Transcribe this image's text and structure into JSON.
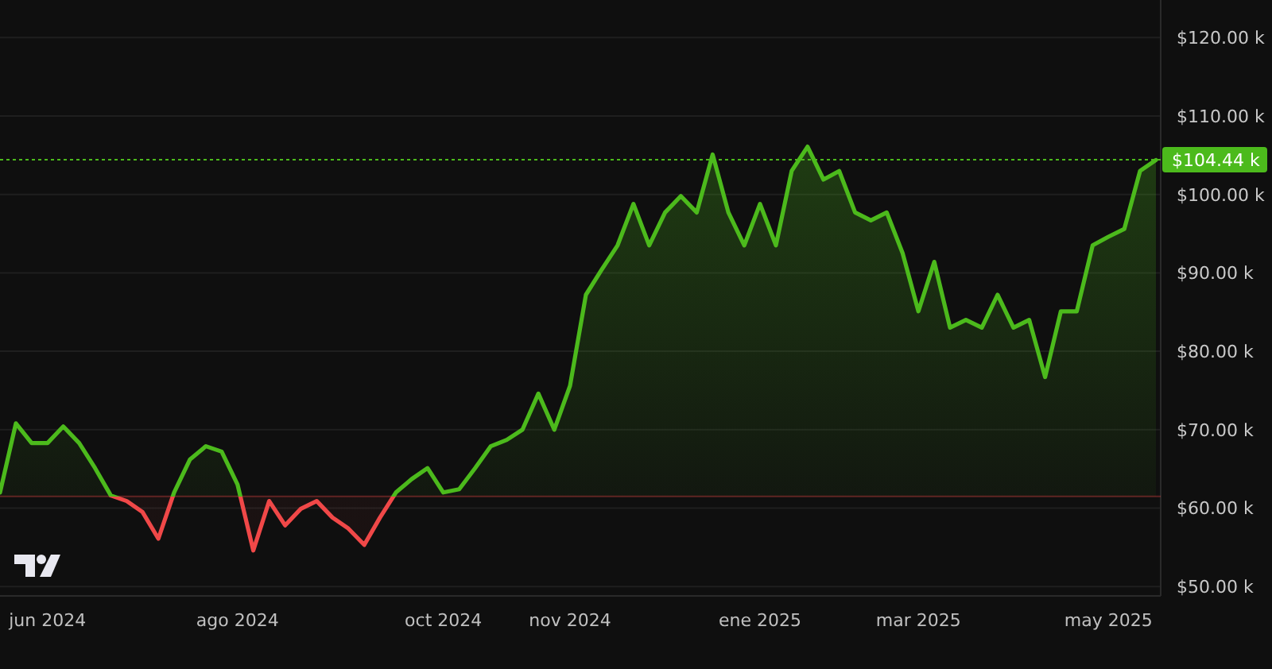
{
  "chart": {
    "chart_data": {
      "type": "area",
      "grid": true,
      "categories": [
        null,
        null,
        null,
        "jun 2024",
        null,
        null,
        null,
        null,
        null,
        null,
        null,
        null,
        null,
        null,
        null,
        "ago 2024",
        null,
        null,
        null,
        null,
        null,
        null,
        null,
        null,
        null,
        null,
        null,
        null,
        "oct 2024",
        null,
        null,
        null,
        null,
        null,
        null,
        null,
        "nov 2024",
        null,
        null,
        null,
        null,
        null,
        null,
        null,
        null,
        null,
        null,
        null,
        "ene 2025",
        null,
        null,
        null,
        null,
        null,
        null,
        null,
        null,
        null,
        "mar 2025",
        null,
        null,
        null,
        null,
        null,
        null,
        null,
        null,
        null,
        null,
        null,
        "may 2025",
        null,
        null,
        null
      ],
      "series": [
        {
          "color": "#4cba1c",
          "values": [
            62,
            70.8,
            68.3,
            68.3,
            70.4,
            68.3,
            65.1,
            61.6,
            60.9,
            59.5,
            56.1,
            62,
            66.2,
            67.9,
            67.2,
            63,
            54.6,
            60.9,
            57.8,
            59.9,
            60.9,
            58.8,
            57.4,
            55.3,
            58.8,
            62,
            63.7,
            65.1,
            62,
            62.4,
            65.1,
            67.9,
            68.7,
            70,
            74.6,
            70,
            75.6,
            87.2,
            90.4,
            93.5,
            98.8,
            93.5,
            97.7,
            99.8,
            97.7,
            105.1,
            97.7,
            93.5,
            98.8,
            93.5,
            103,
            106.1,
            101.9,
            103,
            97.7,
            96.7,
            97.7,
            92.5,
            85.1,
            91.4,
            83,
            84,
            83,
            87.2,
            83,
            84,
            76.7,
            85.1,
            85.1,
            93.5,
            94.6,
            95.6,
            103,
            104.4
          ]
        }
      ],
      "ylim": [
        48.8,
        124.8
      ],
      "yticks": [
        {
          "value": 50,
          "label": "$50.00 k"
        },
        {
          "value": 60,
          "label": "$60.00 k"
        },
        {
          "value": 70,
          "label": "$70.00 k"
        },
        {
          "value": 80,
          "label": "$80.00 k"
        },
        {
          "value": 90,
          "label": "$90.00 k"
        },
        {
          "value": 100,
          "label": "$100.00 k"
        },
        {
          "value": 110,
          "label": "$110.00 k"
        },
        {
          "value": 120,
          "label": "$120.00 k"
        }
      ],
      "ref_lines": [
        {
          "axis": "y",
          "value": 61.5,
          "color": "#f04848"
        },
        {
          "axis": "y",
          "value": 104.44,
          "label": "$104.44 k",
          "color": "#4cba1c"
        }
      ]
    }
  }
}
